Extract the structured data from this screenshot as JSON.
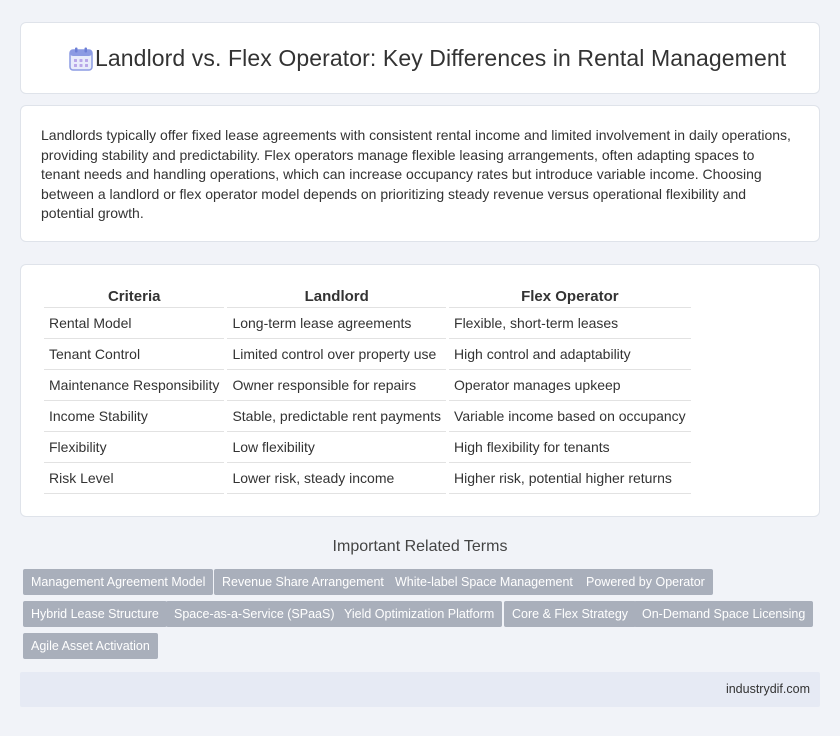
{
  "header": {
    "icon": "calendar-icon",
    "title": "Landlord vs. Flex Operator: Key Differences in Rental Management"
  },
  "intro": {
    "text": "Landlords typically offer fixed lease agreements with consistent rental income and limited involvement in daily operations, providing stability and predictability. Flex operators manage flexible leasing arrangements, often adapting spaces to tenant needs and handling operations, which can increase occupancy rates but introduce variable income. Choosing between a landlord or flex operator model depends on prioritizing steady revenue versus operational flexibility and potential growth."
  },
  "table": {
    "headers": [
      "Criteria",
      "Landlord",
      "Flex Operator"
    ],
    "rows": [
      [
        "Rental Model",
        "Long-term lease agreements",
        "Flexible, short-term leases"
      ],
      [
        "Tenant Control",
        "Limited control over property use",
        "High control and adaptability"
      ],
      [
        "Maintenance Responsibility",
        "Owner responsible for repairs",
        "Operator manages upkeep"
      ],
      [
        "Income Stability",
        "Stable, predictable rent payments",
        "Variable income based on occupancy"
      ],
      [
        "Flexibility",
        "Low flexibility",
        "High flexibility for tenants"
      ],
      [
        "Risk Level",
        "Lower risk, steady income",
        "Higher risk, potential higher returns"
      ]
    ]
  },
  "related": {
    "title": "Important Related Terms",
    "tags": [
      "Management Agreement Model",
      "Revenue Share Arrangement",
      "White-label Space Management",
      "Powered by Operator",
      "Hybrid Lease Structure",
      "Space-as-a-Service (SPaaS)",
      "Yield Optimization Platform",
      "Core & Flex Strategy",
      "On-Demand Space Licensing",
      "Agile Asset Activation"
    ]
  },
  "footer": {
    "site": "industrydif.com"
  },
  "colors": {
    "background": "#f1f3f8",
    "tag_bg": "#a9afbb",
    "footer_bg": "#e6eaf4",
    "icon_accent": "#7b8fe0"
  }
}
